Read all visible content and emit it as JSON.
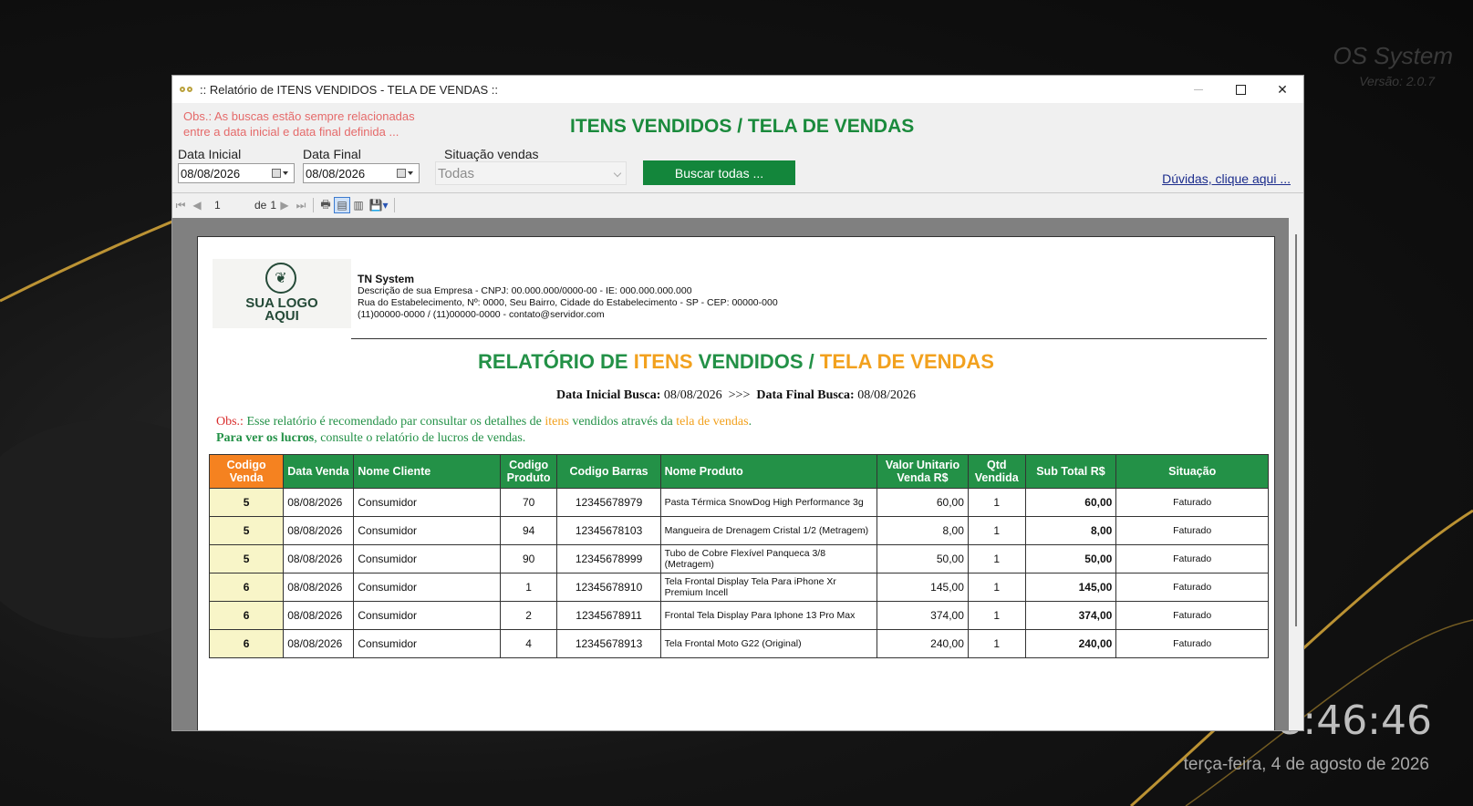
{
  "desktop": {
    "brand_name": "OS System",
    "brand_version": "Versão: 2.0.7",
    "clock": "8:46:46",
    "date": "terça-feira, 4 de agosto de 2026"
  },
  "window": {
    "title": ":: Relatório de ITENS VENDIDOS - TELA DE VENDAS ::",
    "close_glyph": "✕"
  },
  "filters": {
    "obs_line1": "Obs.: As buscas estão sempre relacionadas",
    "obs_line2": "entre a data inicial e data final definida ...",
    "heading": "ITENS VENDIDOS / TELA DE VENDAS",
    "data_inicial_label": "Data Inicial",
    "data_inicial_value": "08/08/2026",
    "data_final_label": "Data Final",
    "data_final_value": "08/08/2026",
    "situacao_label": "Situação vendas",
    "situacao_value": "Todas",
    "search_button": "Buscar todas ...",
    "help_link": "Dúvidas, clique aqui ..."
  },
  "toolbar": {
    "page_current": "1",
    "page_of_label": "de",
    "page_total": "1"
  },
  "report": {
    "logo_line1": "SUA LOGO",
    "logo_line2": "AQUI",
    "company_name": "TN System",
    "company_line1": "Descrição de sua Empresa  - CNPJ: 00.000.000/0000-00 -  IE: 000.000.000.000",
    "company_line2": "Rua do Estabelecimento,  Nº: 0000,  Seu Bairro,  Cidade do Estabelecimento - SP -  CEP: 00000-000",
    "company_line3": "(11)00000-0000 /  (11)00000-0000 -  contato@servidor.com",
    "title_part1": "RELATÓRIO DE ",
    "title_part2": "ITENS",
    "title_part3": " VENDIDOS / ",
    "title_part4": "TELA DE VENDAS",
    "date_start_label": "Data Inicial Busca:",
    "date_start_value": "08/08/2026",
    "date_sep": ">>>",
    "date_end_label": "Data Final Busca:",
    "date_end_value": "08/08/2026",
    "obs_label": "Obs.:",
    "obs_text1": "  Esse relatório é recomendado par consultar os detalhes de ",
    "obs_itens": "itens",
    "obs_text2": " vendidos através da ",
    "obs_tela": "tela de vendas",
    "obs_text3": ".",
    "obs2_bold": "Para ver os lucros",
    "obs2_text": ", consulte o relatório de lucros de vendas.",
    "columns": [
      "Codigo Venda",
      "Data Venda",
      "Nome Cliente",
      "Codigo Produto",
      "Codigo Barras",
      "Nome Produto",
      "Valor Unitario Venda R$",
      "Qtd Vendida",
      "Sub Total R$",
      "Situação"
    ],
    "rows": [
      [
        "5",
        "08/08/2026",
        "Consumidor",
        "70",
        "12345678979",
        "Pasta Térmica SnowDog High Performance 3g",
        "60,00",
        "1",
        "60,00",
        "Faturado"
      ],
      [
        "5",
        "08/08/2026",
        "Consumidor",
        "94",
        "12345678103",
        "Mangueira de Drenagem Cristal 1/2 (Metragem)",
        "8,00",
        "1",
        "8,00",
        "Faturado"
      ],
      [
        "5",
        "08/08/2026",
        "Consumidor",
        "90",
        "12345678999",
        "Tubo de Cobre Flexível Panqueca 3/8 (Metragem)",
        "50,00",
        "1",
        "50,00",
        "Faturado"
      ],
      [
        "6",
        "08/08/2026",
        "Consumidor",
        "1",
        "12345678910",
        "Tela Frontal Display Tela Para iPhone Xr Premium Incell",
        "145,00",
        "1",
        "145,00",
        "Faturado"
      ],
      [
        "6",
        "08/08/2026",
        "Consumidor",
        "2",
        "12345678911",
        "Frontal Tela Display Para Iphone 13 Pro Max",
        "374,00",
        "1",
        "374,00",
        "Faturado"
      ],
      [
        "6",
        "08/08/2026",
        "Consumidor",
        "4",
        "12345678913",
        "Tela Frontal Moto G22 (Original)",
        "240,00",
        "1",
        "240,00",
        "Faturado"
      ]
    ]
  },
  "colors": {
    "green": "#239147",
    "orange": "#f2a11e",
    "button_green": "#13863b",
    "header_orange": "#f58220"
  }
}
